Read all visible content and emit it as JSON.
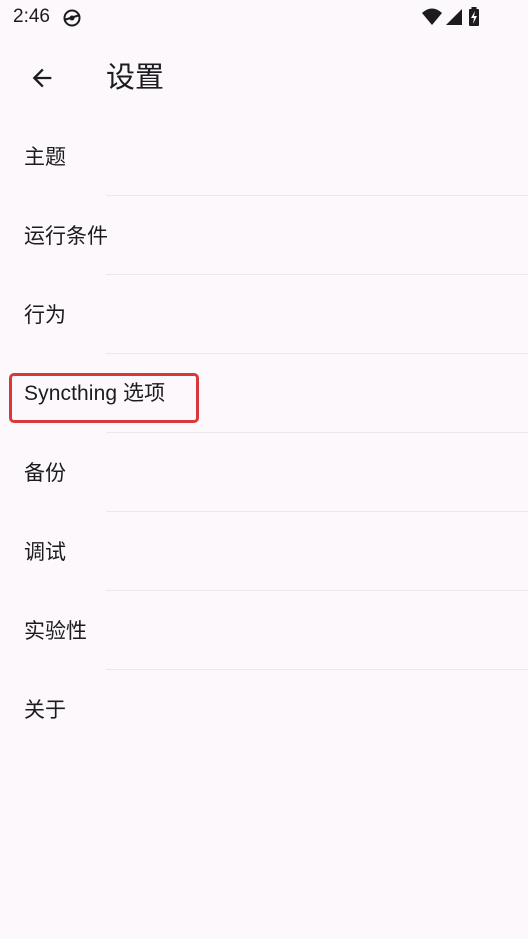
{
  "status_bar": {
    "time": "2:46"
  },
  "app_bar": {
    "title": "设置",
    "back_icon": "arrow-back-icon"
  },
  "settings": {
    "items": [
      {
        "label": "主题"
      },
      {
        "label": "运行条件"
      },
      {
        "label": "行为"
      },
      {
        "label": "Syncthing 选项"
      },
      {
        "label": "备份"
      },
      {
        "label": "调试"
      },
      {
        "label": "实验性"
      },
      {
        "label": "关于"
      }
    ]
  },
  "colors": {
    "background": "#fdf8fc",
    "text": "#1c1b1f",
    "divider": "#ece7ec",
    "highlight": "#d9383b"
  }
}
